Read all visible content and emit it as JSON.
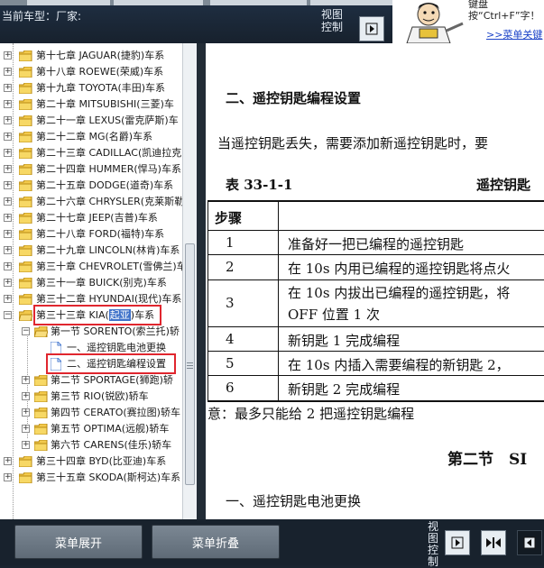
{
  "header": {
    "current_car_label": "当前车型：厂家:",
    "view_control_label": "视图控制"
  },
  "ad": {
    "text": "键盘按“Ctrl+F”字！",
    "link": ">>菜单关键"
  },
  "tree": {
    "chapters": [
      {
        "label": "第十七章 JAGUAR(捷豹)车系"
      },
      {
        "label": "第十八章 ROEWE(荣威)车系"
      },
      {
        "label": "第十九章 TOYOTA(丰田)车系"
      },
      {
        "label": "第二十章 MITSUBISHI(三菱)车"
      },
      {
        "label": "第二十一章 LEXUS(雷克萨斯)车"
      },
      {
        "label": "第二十二章 MG(名爵)车系"
      },
      {
        "label": "第二十三章 CADILLAC(凯迪拉克"
      },
      {
        "label": "第二十四章 HUMMER(悍马)车系"
      },
      {
        "label": "第二十五章 DODGE(道奇)车系"
      },
      {
        "label": "第二十六章 CHRYSLER(克莱斯勒"
      },
      {
        "label": "第二十七章 JEEP(吉普)车系"
      },
      {
        "label": "第二十八章 FORD(福特)车系"
      },
      {
        "label": "第二十九章 LINCOLN(林肯)车系"
      },
      {
        "label": "第三十章 CHEVROLET(雪佛兰)车"
      },
      {
        "label": "第三十一章 BUICK(别克)车系"
      },
      {
        "label": "第三十二章 HYUNDAI(现代)车系"
      }
    ],
    "kia_prefix": "第三十三章 KIA(",
    "kia_selected": "起亚",
    "kia_suffix": ")车系",
    "kia_children": {
      "section1": "第一节 SORENTO(索兰托)轿",
      "item1": "一、遥控钥匙电池更换",
      "item2": "二、遥控钥匙编程设置",
      "sections": [
        {
          "label": "第二节 SPORTAGE(狮跑)轿"
        },
        {
          "label": "第三节 RIO(锐欧)轿车"
        },
        {
          "label": "第四节 CERATO(赛拉图)轿车"
        },
        {
          "label": "第五节 OPTIMA(远舰)轿车"
        },
        {
          "label": "第六节 CARENS(佳乐)轿车"
        }
      ]
    },
    "after": [
      {
        "label": "第三十四章 BYD(比亚迪)车系"
      },
      {
        "label": "第三十五章 SKODA(斯柯达)车系"
      }
    ]
  },
  "doc": {
    "heading": "二、遥控钥匙编程设置",
    "intro": "当遥控钥匙丢失，需要添加新遥控钥匙时，要",
    "table_id": "表 33-1-1",
    "table_title": "遥控钥匙",
    "step_header": "步骤",
    "steps": [
      {
        "n": "1",
        "text": "准备好一把已编程的遥控钥匙"
      },
      {
        "n": "2",
        "text": "在 10s 内用已编程的遥控钥匙将点火"
      },
      {
        "n": "3",
        "text": "在 10s 内拔出已编程的遥控钥匙，将",
        "text2": "OFF 位置 1 次"
      },
      {
        "n": "4",
        "text": "新钥匙 1 完成编程"
      },
      {
        "n": "5",
        "text": "在 10s 内插入需要编程的新钥匙 2，"
      },
      {
        "n": "6",
        "text": "新钥匙 2 完成编程"
      }
    ],
    "note": "意：最多只能给 2 把遥控钥匙编程",
    "section_heading": "第二节　SI",
    "subheading": "一、遥控钥匙电池更换"
  },
  "bottom": {
    "expand_label": "菜单展开",
    "collapse_label": "菜单折叠",
    "view_control_label": "视图控制"
  }
}
